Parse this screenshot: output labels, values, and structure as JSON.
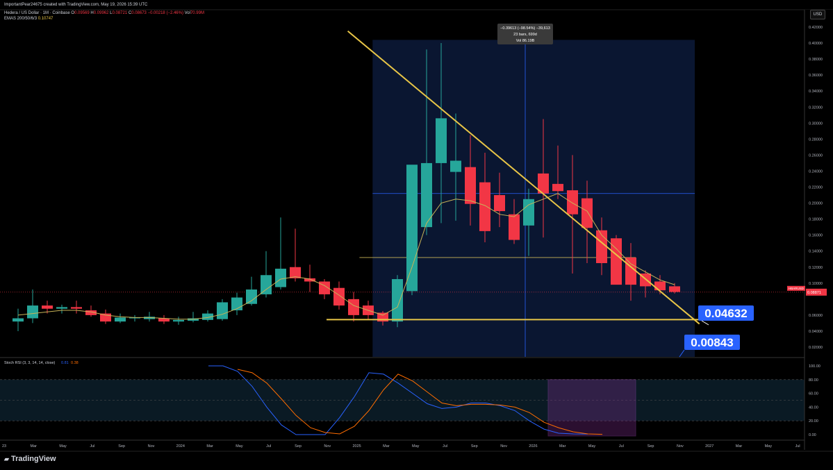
{
  "header": {
    "attribution": "ImportantPear24675 created with TradingView.com, May 19, 2026 15:39 UTC",
    "symbol_line": "Hedera / US Dollar · 1M · Coinbase",
    "ohlc": {
      "o_label": "O",
      "o": "0.09569",
      "h_label": "H",
      "h": "0.09962",
      "l_label": "L",
      "l": "0.08721",
      "c_label": "C",
      "c": "0.08673",
      "change": "−0.00218 (−2.46%)",
      "vol_label": "Vol",
      "vol": "70.99M"
    },
    "ema_line": "EMAS 200/50/6/3",
    "ema_values": [
      "0.10747"
    ],
    "currency_button": "USD"
  },
  "measure_box": {
    "line1": "−0.39613 (−98.54%) −39,613",
    "line2": "23 bars, 699d",
    "line3": "Vol 86.19B"
  },
  "price_axis": {
    "ticks": [
      "0.42000",
      "0.40000",
      "0.38000",
      "0.36000",
      "0.34000",
      "0.32000",
      "0.30000",
      "0.28000",
      "0.26000",
      "0.24000",
      "0.22000",
      "0.20000",
      "0.18000",
      "0.16000",
      "0.14000",
      "0.12000",
      "0.10000",
      "0.06000",
      "0.04000",
      "0.02000"
    ],
    "current_price_label": "0.08871",
    "symbol_tag": "HBARUSD"
  },
  "callouts": {
    "upper": "0.04632",
    "lower": "0.00843"
  },
  "time_axis": {
    "labels": [
      "23",
      "Mar",
      "May",
      "Jul",
      "Sep",
      "Nov",
      "2024",
      "Mar",
      "May",
      "Jul",
      "Sep",
      "Nov",
      "2025",
      "Mar",
      "May",
      "Jul",
      "Sep",
      "Nov",
      "2026",
      "Mar",
      "May",
      "Jul",
      "Sep",
      "Nov",
      "2027",
      "Mar",
      "May",
      "Jul"
    ]
  },
  "stoch": {
    "title": "Stoch RSI (3, 3, 14, 14, close)",
    "k_value": "0.81",
    "d_value": "0.38",
    "ticks": [
      "100.00",
      "80.00",
      "60.00",
      "40.00",
      "20.00",
      "0.00"
    ]
  },
  "branding": {
    "logo_text": "TradingView"
  },
  "colors": {
    "up": "#26a69a",
    "down": "#f23645",
    "ema": "#c9b458",
    "trendline": "#e8c547",
    "range_box": "#0c1a3a",
    "callout": "#2962ff",
    "k_line": "#2962ff",
    "d_line": "#ff6d00",
    "stoch_box": "#7b2d8a"
  },
  "chart_data": {
    "type": "candlestick",
    "timeframe": "1M",
    "ylim": [
      0.0,
      0.43
    ],
    "candles": [
      {
        "o": 0.052,
        "h": 0.068,
        "l": 0.04,
        "c": 0.056
      },
      {
        "o": 0.056,
        "h": 0.092,
        "l": 0.05,
        "c": 0.072
      },
      {
        "o": 0.072,
        "h": 0.078,
        "l": 0.062,
        "c": 0.068
      },
      {
        "o": 0.068,
        "h": 0.073,
        "l": 0.062,
        "c": 0.07
      },
      {
        "o": 0.07,
        "h": 0.078,
        "l": 0.062,
        "c": 0.068
      },
      {
        "o": 0.066,
        "h": 0.072,
        "l": 0.058,
        "c": 0.06
      },
      {
        "o": 0.062,
        "h": 0.067,
        "l": 0.049,
        "c": 0.052
      },
      {
        "o": 0.052,
        "h": 0.062,
        "l": 0.05,
        "c": 0.057
      },
      {
        "o": 0.056,
        "h": 0.06,
        "l": 0.052,
        "c": 0.057
      },
      {
        "o": 0.055,
        "h": 0.064,
        "l": 0.052,
        "c": 0.058
      },
      {
        "o": 0.056,
        "h": 0.06,
        "l": 0.049,
        "c": 0.052
      },
      {
        "o": 0.052,
        "h": 0.058,
        "l": 0.048,
        "c": 0.054
      },
      {
        "o": 0.053,
        "h": 0.064,
        "l": 0.051,
        "c": 0.056
      },
      {
        "o": 0.054,
        "h": 0.066,
        "l": 0.052,
        "c": 0.062
      },
      {
        "o": 0.055,
        "h": 0.08,
        "l": 0.053,
        "c": 0.076
      },
      {
        "o": 0.066,
        "h": 0.088,
        "l": 0.06,
        "c": 0.082
      },
      {
        "o": 0.074,
        "h": 0.108,
        "l": 0.072,
        "c": 0.092
      },
      {
        "o": 0.086,
        "h": 0.14,
        "l": 0.082,
        "c": 0.11
      },
      {
        "o": 0.095,
        "h": 0.182,
        "l": 0.092,
        "c": 0.118
      },
      {
        "o": 0.12,
        "h": 0.168,
        "l": 0.102,
        "c": 0.106
      },
      {
        "o": 0.106,
        "h": 0.123,
        "l": 0.089,
        "c": 0.102
      },
      {
        "o": 0.102,
        "h": 0.105,
        "l": 0.08,
        "c": 0.086
      },
      {
        "o": 0.094,
        "h": 0.102,
        "l": 0.067,
        "c": 0.072
      },
      {
        "o": 0.08,
        "h": 0.089,
        "l": 0.052,
        "c": 0.06
      },
      {
        "o": 0.072,
        "h": 0.078,
        "l": 0.054,
        "c": 0.06
      },
      {
        "o": 0.063,
        "h": 0.065,
        "l": 0.047,
        "c": 0.052
      },
      {
        "o": 0.052,
        "h": 0.11,
        "l": 0.045,
        "c": 0.105
      },
      {
        "o": 0.09,
        "h": 0.181,
        "l": 0.085,
        "c": 0.248
      },
      {
        "o": 0.17,
        "h": 0.392,
        "l": 0.16,
        "c": 0.25
      },
      {
        "o": 0.25,
        "h": 0.4,
        "l": 0.175,
        "c": 0.306
      },
      {
        "o": 0.239,
        "h": 0.312,
        "l": 0.178,
        "c": 0.253
      },
      {
        "o": 0.245,
        "h": 0.285,
        "l": 0.172,
        "c": 0.199
      },
      {
        "o": 0.226,
        "h": 0.263,
        "l": 0.151,
        "c": 0.165
      },
      {
        "o": 0.21,
        "h": 0.238,
        "l": 0.17,
        "c": 0.19
      },
      {
        "o": 0.186,
        "h": 0.205,
        "l": 0.149,
        "c": 0.154
      },
      {
        "o": 0.172,
        "h": 0.218,
        "l": 0.134,
        "c": 0.205
      },
      {
        "o": 0.237,
        "h": 0.305,
        "l": 0.157,
        "c": 0.212
      },
      {
        "o": 0.224,
        "h": 0.272,
        "l": 0.205,
        "c": 0.215
      },
      {
        "o": 0.216,
        "h": 0.26,
        "l": 0.112,
        "c": 0.186
      },
      {
        "o": 0.206,
        "h": 0.228,
        "l": 0.125,
        "c": 0.169
      },
      {
        "o": 0.166,
        "h": 0.182,
        "l": 0.11,
        "c": 0.125
      },
      {
        "o": 0.156,
        "h": 0.16,
        "l": 0.11,
        "c": 0.098
      },
      {
        "o": 0.132,
        "h": 0.15,
        "l": 0.078,
        "c": 0.098
      },
      {
        "o": 0.112,
        "h": 0.116,
        "l": 0.082,
        "c": 0.096
      },
      {
        "o": 0.102,
        "h": 0.11,
        "l": 0.086,
        "c": 0.091
      },
      {
        "o": 0.096,
        "h": 0.1,
        "l": 0.087,
        "c": 0.089
      }
    ],
    "ema": [
      0.06,
      0.062,
      0.064,
      0.066,
      0.066,
      0.064,
      0.06,
      0.058,
      0.057,
      0.057,
      0.056,
      0.055,
      0.055,
      0.057,
      0.061,
      0.068,
      0.078,
      0.092,
      0.105,
      0.108,
      0.105,
      0.097,
      0.085,
      0.072,
      0.066,
      0.06,
      0.07,
      0.12,
      0.175,
      0.2,
      0.205,
      0.203,
      0.197,
      0.186,
      0.183,
      0.198,
      0.205,
      0.212,
      0.2,
      0.19,
      0.16,
      0.143,
      0.124,
      0.114,
      0.104,
      0.098
    ],
    "trendline_upper": {
      "from": [
        28,
        0.415
      ],
      "to": [
        52,
        0.049
      ]
    },
    "support_line": 0.05,
    "range_box": {
      "top": 0.404,
      "bottom": 0.0
    },
    "midline": 0.212,
    "lower_box_line": 0.132,
    "stoch_k": [
      100,
      100,
      92,
      70,
      40,
      14,
      0,
      0,
      0,
      25,
      55,
      90,
      88,
      75,
      60,
      45,
      38,
      40,
      46,
      46,
      42,
      35,
      20,
      8,
      2,
      1,
      0.81
    ],
    "stoch_d": [
      95,
      90,
      75,
      52,
      28,
      10,
      3,
      1,
      12,
      35,
      65,
      88,
      78,
      62,
      46,
      42,
      44,
      44,
      43,
      40,
      32,
      18,
      10,
      4,
      1,
      0.38
    ],
    "stoch_range": [
      0,
      100
    ]
  }
}
